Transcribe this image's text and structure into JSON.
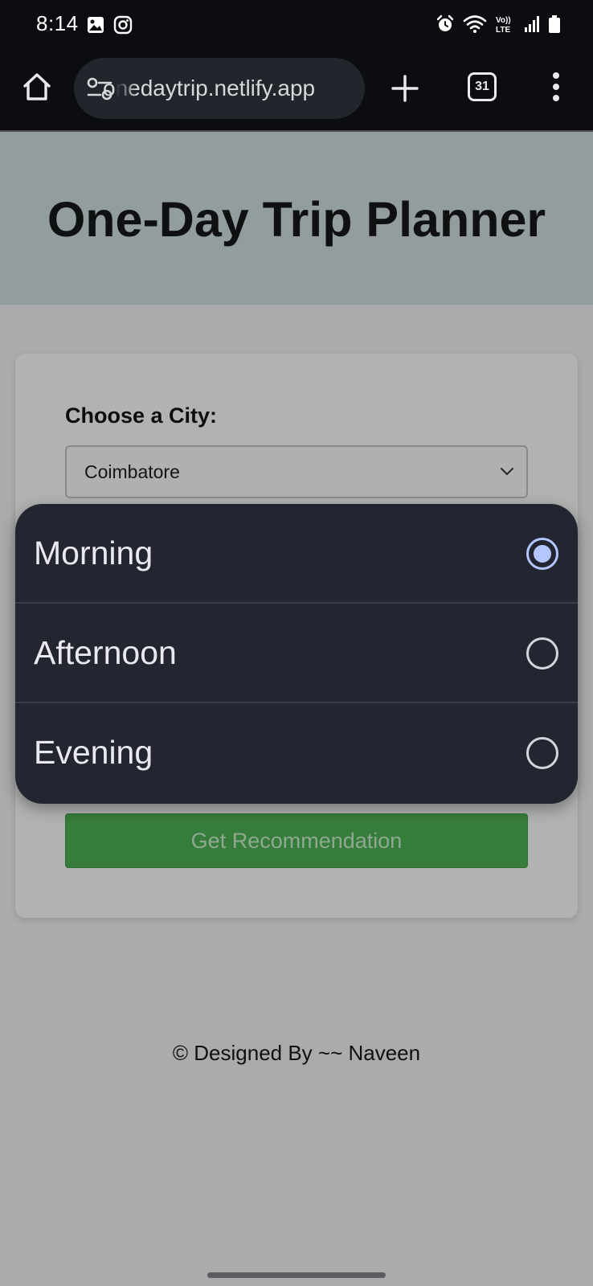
{
  "status_bar": {
    "time": "8:14",
    "left_icons": [
      "gallery-icon",
      "instagram-icon"
    ],
    "right_icons": [
      "alarm-icon",
      "wifi-icon",
      "volte-icon",
      "signal-icon",
      "battery-icon"
    ],
    "volte_text": "Vo)) LTE"
  },
  "browser": {
    "url": "onedaytrip.netlify.app",
    "tab_count": "31"
  },
  "page": {
    "title": "One-Day Trip Planner",
    "city_label": "Choose a City:",
    "city_selected": "Coimbatore",
    "submit_label": "Get Recommendation",
    "footer": "© Designed By ~~ Naveen"
  },
  "dropdown": {
    "options": [
      {
        "label": "Morning",
        "selected": true
      },
      {
        "label": "Afternoon",
        "selected": false
      },
      {
        "label": "Evening",
        "selected": false
      }
    ]
  },
  "colors": {
    "status_bg": "#0b0d10",
    "header_bg": "#939c9e",
    "page_bg": "#a9abad",
    "sheet_bg": "#232531",
    "radio_accent": "#b4c6ff",
    "button_green": "#367c3a"
  }
}
